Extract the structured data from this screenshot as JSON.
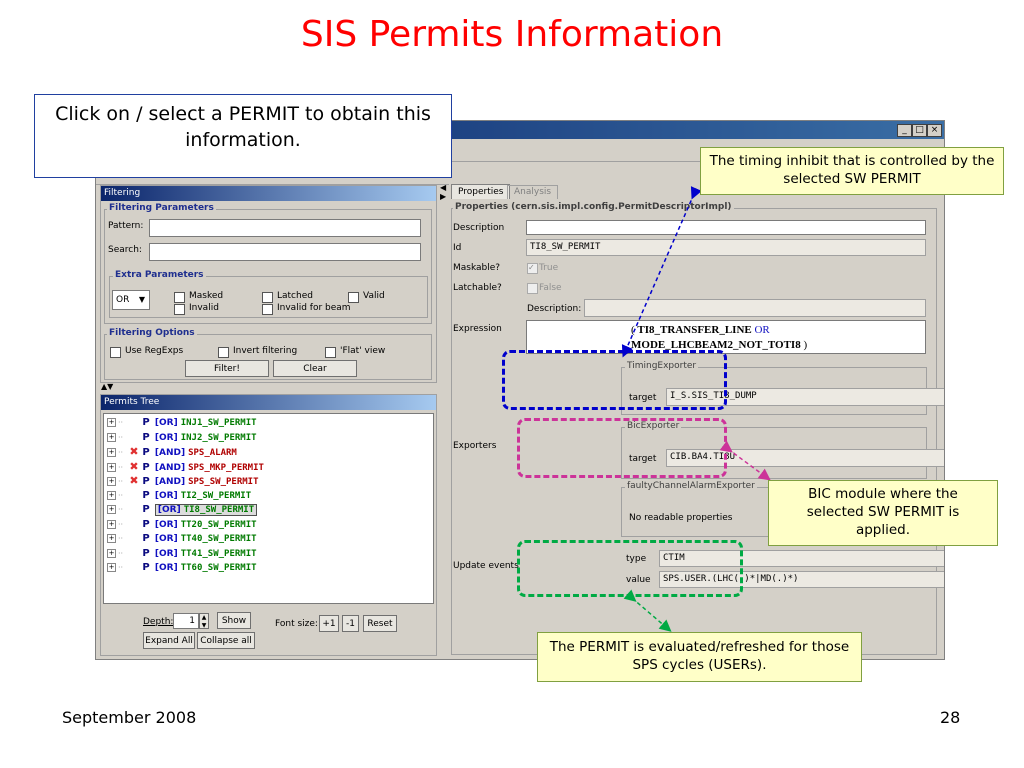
{
  "slide": {
    "title": "SIS Permits Information",
    "footer_date": "September 2008",
    "page_number": "28"
  },
  "instruction_box": "Click on / select a PERMIT to obtain this information.",
  "window": {
    "controls": [
      "_",
      "□",
      "×"
    ]
  },
  "filtering": {
    "panel_title": "Filtering",
    "params_title": "Filtering Parameters",
    "pattern_label": "Pattern:",
    "pattern_value": "",
    "search_label": "Search:",
    "search_value": "",
    "extra_title": "Extra Parameters",
    "combo_value": "OR",
    "checks": {
      "masked": "Masked",
      "latched": "Latched",
      "valid": "Valid",
      "invalid": "Invalid",
      "invalid_for_beam": "Invalid for beam"
    },
    "options_title": "Filtering Options",
    "use_regexps": "Use RegExps",
    "invert_filtering": "Invert filtering",
    "flat_view": "'Flat' view",
    "filter_button": "Filter!",
    "clear_button": "Clear"
  },
  "tree": {
    "panel_title": "Permits Tree",
    "rows": [
      {
        "type": "[OR]",
        "name": "INJ1_SW_PERMIT",
        "red_x": false,
        "color": "#007a00",
        "selected": false
      },
      {
        "type": "[OR]",
        "name": "INJ2_SW_PERMIT",
        "red_x": false,
        "color": "#007a00",
        "selected": false
      },
      {
        "type": "[AND]",
        "name": "SPS_ALARM",
        "red_x": true,
        "color": "#b00000",
        "selected": false
      },
      {
        "type": "[AND]",
        "name": "SPS_MKP_PERMIT",
        "red_x": true,
        "color": "#b00000",
        "selected": false
      },
      {
        "type": "[AND]",
        "name": "SPS_SW_PERMIT",
        "red_x": true,
        "color": "#b00000",
        "selected": false
      },
      {
        "type": "[OR]",
        "name": "TI2_SW_PERMIT",
        "red_x": false,
        "color": "#007a00",
        "selected": false
      },
      {
        "type": "[OR]",
        "name": "TI8_SW_PERMIT",
        "red_x": false,
        "color": "#007a00",
        "selected": true
      },
      {
        "type": "[OR]",
        "name": "TT20_SW_PERMIT",
        "red_x": false,
        "color": "#007a00",
        "selected": false
      },
      {
        "type": "[OR]",
        "name": "TT40_SW_PERMIT",
        "red_x": false,
        "color": "#007a00",
        "selected": false
      },
      {
        "type": "[OR]",
        "name": "TT41_SW_PERMIT",
        "red_x": false,
        "color": "#007a00",
        "selected": false
      },
      {
        "type": "[OR]",
        "name": "TT60_SW_PERMIT",
        "red_x": false,
        "color": "#007a00",
        "selected": false
      }
    ],
    "depth_label": "Depth:",
    "depth_value": "1",
    "show_button": "Show",
    "font_size_label": "Font size:",
    "plus_button": "+1",
    "minus_button": "-1",
    "reset_button": "Reset",
    "expand_all": "Expand All",
    "collapse_all": "Collapse all"
  },
  "properties": {
    "tab_properties": "Properties",
    "tab_analysis": "Analysis",
    "group_title": "Properties (cern.sis.impl.config.PermitDescriptorImpl)",
    "description_label": "Description",
    "description_value": "",
    "id_label": "Id",
    "id_value": "TI8_SW_PERMIT",
    "maskable_label": "Maskable?",
    "maskable_value": "True",
    "latchable_label": "Latchable?",
    "latchable_value": "False",
    "desc2_label": "Description:",
    "expression_label": "Expression",
    "expression_open": "( ",
    "expression_part1": "TI8_TRANSFER_LINE",
    "expression_op": " OR",
    "expression_part2": "MODE_LHCBEAM2_NOT_TOTI8",
    "expression_close": " )",
    "exporters_label": "Exporters",
    "timing_exporter": "TimingExporter",
    "timing_target_label": "target",
    "timing_target_value": "I_S.SIS_TI8_DUMP",
    "bic_exporter": "BicExporter",
    "bic_target_label": "target",
    "bic_target_value": "CIB.BA4.TI8U",
    "faulty_exporter": "faultyChannelAlarmExporter",
    "faulty_text": "No readable properties",
    "update_events_label": "Update events",
    "type_label": "type",
    "type_value": "CTIM",
    "value_label": "value",
    "value_value": "SPS.USER.(LHC(.)*|MD(.)*)"
  },
  "callouts": {
    "timing": "The timing inhibit that is controlled by the selected SW PERMIT",
    "bic": "BIC module where the selected SW PERMIT is applied.",
    "update": "The PERMIT is evaluated/refreshed for those SPS cycles (USERs)."
  },
  "colors": {
    "title_red": "#ff0000",
    "timing_blue": "#0000cc",
    "bic_magenta": "#cc3399",
    "update_green": "#00aa44"
  }
}
